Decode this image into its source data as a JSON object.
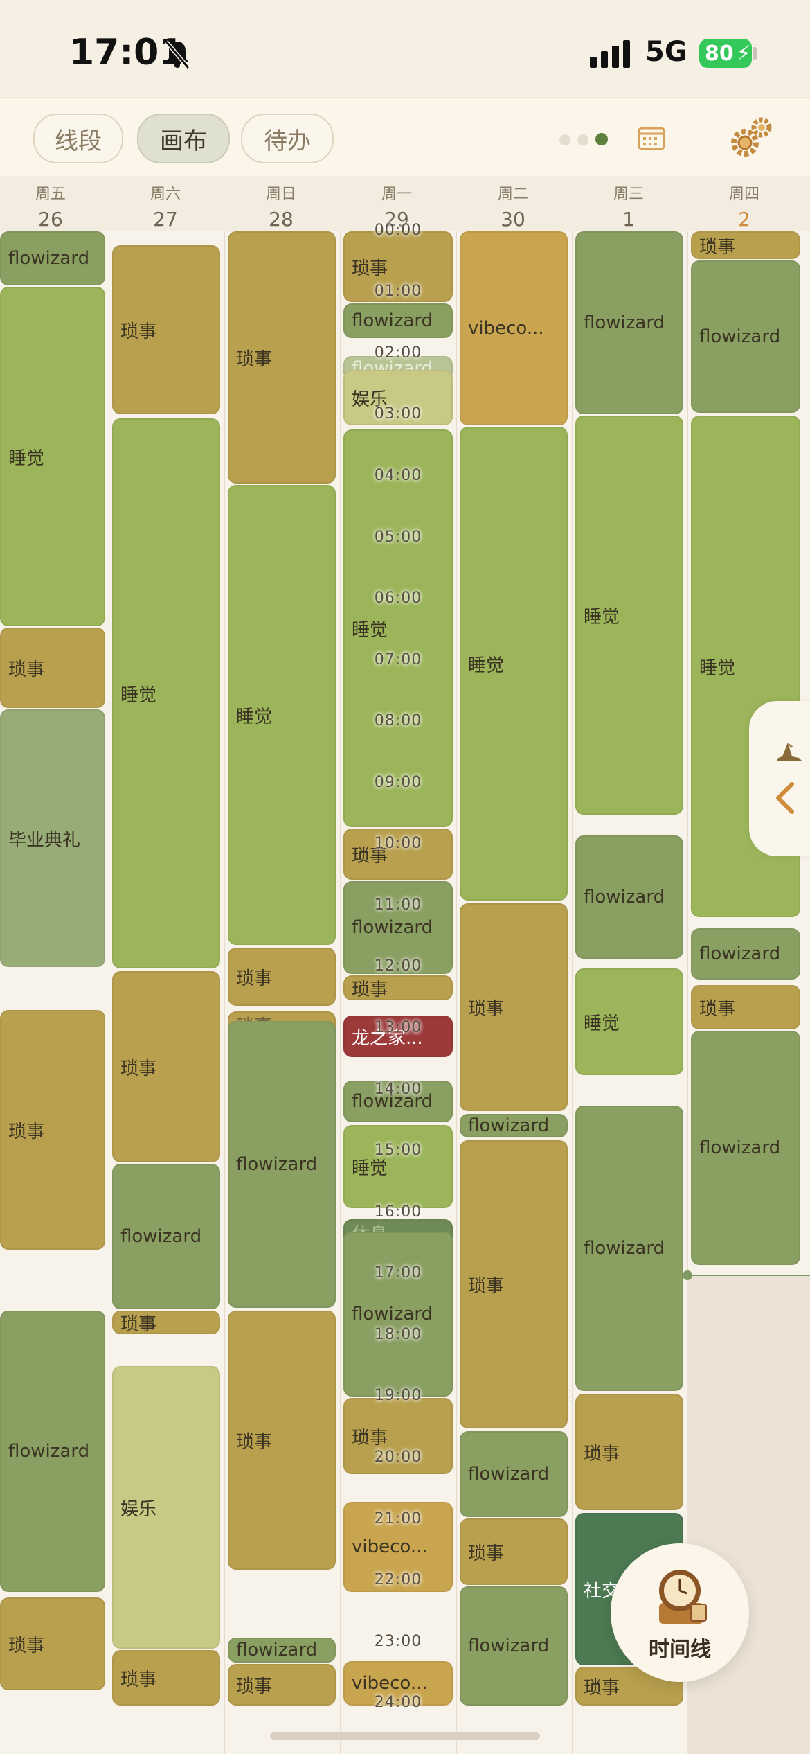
{
  "status_bar": {
    "time": "17:01",
    "network": "5G",
    "battery": "80"
  },
  "toolbar": {
    "tabs": [
      {
        "label": "线段"
      },
      {
        "label": "画布"
      },
      {
        "label": "待办"
      }
    ],
    "active_tab": "画布"
  },
  "days": [
    {
      "weekday": "周五",
      "date": "26"
    },
    {
      "weekday": "周六",
      "date": "27"
    },
    {
      "weekday": "周日",
      "date": "28"
    },
    {
      "weekday": "周一",
      "date": "29"
    },
    {
      "weekday": "周二",
      "date": "30"
    },
    {
      "weekday": "周三",
      "date": "1"
    },
    {
      "weekday": "周四",
      "date": "2"
    }
  ],
  "hours": [
    "00:00",
    "01:00",
    "02:00",
    "03:00",
    "04:00",
    "05:00",
    "06:00",
    "07:00",
    "08:00",
    "09:00",
    "10:00",
    "11:00",
    "12:00",
    "13:00",
    "14:00",
    "15:00",
    "16:00",
    "17:00",
    "18:00",
    "19:00",
    "20:00",
    "21:00",
    "22:00",
    "23:00",
    "24:00"
  ],
  "colors": {
    "sleep": "#9cb55a",
    "chores": "#b8a04e",
    "flowizard": "#8a9f62",
    "entertainment": "#c8c985",
    "graduation": "#98ac78",
    "vibecoding": "#c9a550",
    "dragon": "#9c3a3a",
    "social": "#4d7a52",
    "rest": "#6f8b55",
    "accent": "#5f7f3d"
  },
  "events": [
    {
      "label": "flowizard"
    },
    {
      "label": "睡觉"
    },
    {
      "label": "琐事"
    },
    {
      "label": "毕业典礼"
    },
    {
      "label": "琐事"
    },
    {
      "label": "flowizard"
    },
    {
      "label": "琐事"
    },
    {
      "label": "琐事"
    },
    {
      "label": "睡觉"
    },
    {
      "label": "琐事"
    },
    {
      "label": "flowizard"
    },
    {
      "label": "琐事"
    },
    {
      "label": "娱乐"
    },
    {
      "label": "琐事"
    },
    {
      "label": "琐事"
    },
    {
      "label": "睡觉"
    },
    {
      "label": "琐事"
    },
    {
      "label": "琐事"
    },
    {
      "label": "flowizard"
    },
    {
      "label": "琐事"
    },
    {
      "label": "flowizard"
    },
    {
      "label": "琐事"
    },
    {
      "label": "琐事"
    },
    {
      "label": "flowizard"
    },
    {
      "label": "flowizard"
    },
    {
      "label": "娱乐"
    },
    {
      "label": "睡觉"
    },
    {
      "label": "琐事"
    },
    {
      "label": "flowizard"
    },
    {
      "label": "琐事"
    },
    {
      "label": "龙之家..."
    },
    {
      "label": "flowizard"
    },
    {
      "label": "睡觉"
    },
    {
      "label": "休息"
    },
    {
      "label": "flowizard"
    },
    {
      "label": "琐事"
    },
    {
      "label": "vibeco..."
    },
    {
      "label": "vibeco..."
    },
    {
      "label": "vibeco..."
    },
    {
      "label": "睡觉"
    },
    {
      "label": "琐事"
    },
    {
      "label": "flowizard"
    },
    {
      "label": "琐事"
    },
    {
      "label": "flowizard"
    },
    {
      "label": "琐事"
    },
    {
      "label": "flowizard"
    },
    {
      "label": "flowizard"
    },
    {
      "label": "睡觉"
    },
    {
      "label": "flowizard"
    },
    {
      "label": "睡觉"
    },
    {
      "label": "flowizard"
    },
    {
      "label": "琐事"
    },
    {
      "label": "社交"
    },
    {
      "label": "琐事"
    },
    {
      "label": "琐事"
    },
    {
      "label": "flowizard"
    },
    {
      "label": "睡觉"
    },
    {
      "label": "flowizard"
    },
    {
      "label": "琐事"
    },
    {
      "label": "flowizard"
    }
  ],
  "fab": {
    "label": "时间线"
  }
}
